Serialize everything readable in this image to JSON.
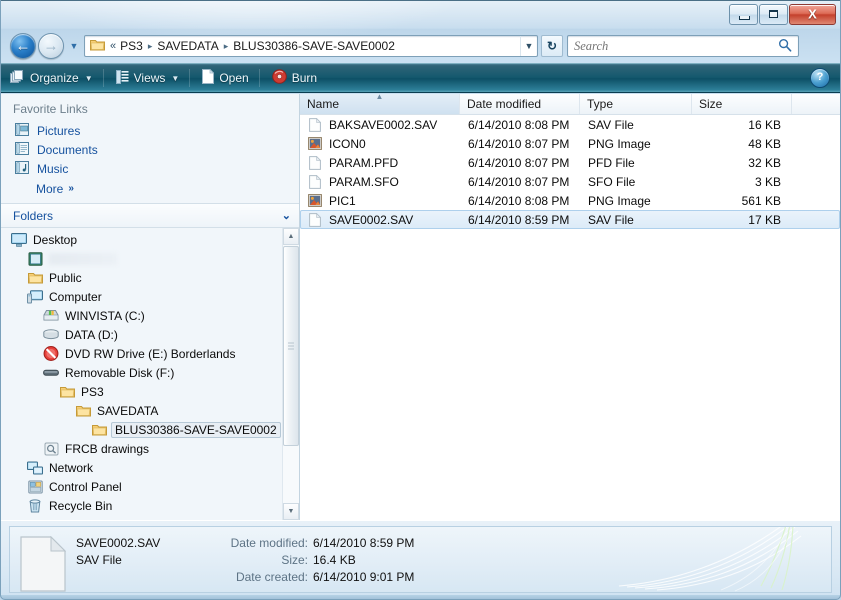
{
  "window": {
    "caption_buttons": {
      "minimize": "minimize-button",
      "maximize": "maximize-button",
      "close_label": "X"
    }
  },
  "address_bar": {
    "back_glyph": "←",
    "forward_glyph": "→",
    "history_caret": "▼",
    "overflow": "«",
    "crumbs": [
      "PS3",
      "SAVEDATA",
      "BLUS30386-SAVE-SAVE0002"
    ],
    "separator": "▸",
    "dropdown_caret": "▼",
    "refresh_glyph": "↻",
    "search": {
      "placeholder": "Search",
      "value": ""
    }
  },
  "toolbar": {
    "organize_label": "Organize",
    "organize_caret": "▼",
    "views_label": "Views",
    "views_caret": "▼",
    "open_label": "Open",
    "burn_label": "Burn",
    "help_glyph": "?"
  },
  "nav_pane": {
    "favorites_header": "Favorite Links",
    "favorites": [
      {
        "label": "Pictures",
        "icon": "pictures-icon"
      },
      {
        "label": "Documents",
        "icon": "documents-icon"
      },
      {
        "label": "Music",
        "icon": "music-icon"
      }
    ],
    "more_label": "More",
    "more_chevron": "»",
    "folders_header": "Folders",
    "folders_chevron": "⌄",
    "tree": [
      {
        "label": "Desktop",
        "indent": 0,
        "icon": "desktop-icon",
        "selected": false,
        "blurred": false
      },
      {
        "label": "",
        "indent": 1,
        "icon": "user-folder-icon",
        "selected": false,
        "blurred": true
      },
      {
        "label": "Public",
        "indent": 1,
        "icon": "folder-icon",
        "selected": false,
        "blurred": false
      },
      {
        "label": "Computer",
        "indent": 1,
        "icon": "computer-icon",
        "selected": false,
        "blurred": false
      },
      {
        "label": "WINVISTA (C:)",
        "indent": 2,
        "icon": "hard-drive-icon",
        "selected": false,
        "blurred": false
      },
      {
        "label": "DATA (D:)",
        "indent": 2,
        "icon": "disk-drive-icon",
        "selected": false,
        "blurred": false
      },
      {
        "label": "DVD RW Drive (E:) Borderlands",
        "indent": 2,
        "icon": "dvd-drive-icon",
        "selected": false,
        "blurred": false
      },
      {
        "label": "Removable Disk (F:)",
        "indent": 2,
        "icon": "removable-disk-icon",
        "selected": false,
        "blurred": false
      },
      {
        "label": "PS3",
        "indent": 3,
        "icon": "folder-icon",
        "selected": false,
        "blurred": false
      },
      {
        "label": "SAVEDATA",
        "indent": 4,
        "icon": "folder-icon",
        "selected": false,
        "blurred": false
      },
      {
        "label": "BLUS30386-SAVE-SAVE0002",
        "indent": 5,
        "icon": "folder-icon",
        "selected": true,
        "blurred": false
      },
      {
        "label": "FRCB drawings",
        "indent": 2,
        "icon": "search-folder-icon",
        "selected": false,
        "blurred": false
      },
      {
        "label": "Network",
        "indent": 1,
        "icon": "network-icon",
        "selected": false,
        "blurred": false
      },
      {
        "label": "Control Panel",
        "indent": 1,
        "icon": "control-panel-icon",
        "selected": false,
        "blurred": false
      },
      {
        "label": "Recycle Bin",
        "indent": 1,
        "icon": "recycle-bin-icon",
        "selected": false,
        "blurred": false
      }
    ]
  },
  "file_list": {
    "columns": [
      {
        "label": "Name",
        "sorted": true,
        "sort_arrow": "▲"
      },
      {
        "label": "Date modified",
        "sorted": false,
        "sort_arrow": ""
      },
      {
        "label": "Type",
        "sorted": false,
        "sort_arrow": ""
      },
      {
        "label": "Size",
        "sorted": false,
        "sort_arrow": ""
      }
    ],
    "rows": [
      {
        "name": "BAKSAVE0002.SAV",
        "date": "6/14/2010 8:08 PM",
        "type": "SAV File",
        "size": "16 KB",
        "icon": "generic-file-icon",
        "selected": false
      },
      {
        "name": "ICON0",
        "date": "6/14/2010 8:07 PM",
        "type": "PNG Image",
        "size": "48 KB",
        "icon": "png-image-icon",
        "selected": false
      },
      {
        "name": "PARAM.PFD",
        "date": "6/14/2010 8:07 PM",
        "type": "PFD File",
        "size": "32 KB",
        "icon": "generic-file-icon",
        "selected": false
      },
      {
        "name": "PARAM.SFO",
        "date": "6/14/2010 8:07 PM",
        "type": "SFO File",
        "size": "3 KB",
        "icon": "generic-file-icon",
        "selected": false
      },
      {
        "name": "PIC1",
        "date": "6/14/2010 8:08 PM",
        "type": "PNG Image",
        "size": "561 KB",
        "icon": "png-image-icon",
        "selected": false
      },
      {
        "name": "SAVE0002.SAV",
        "date": "6/14/2010 8:59 PM",
        "type": "SAV File",
        "size": "17 KB",
        "icon": "generic-file-icon",
        "selected": true
      }
    ]
  },
  "details_pane": {
    "file_name": "SAVE0002.SAV",
    "file_type": "SAV File",
    "date_modified_label": "Date modified:",
    "date_modified_value": "6/14/2010 8:59 PM",
    "size_label": "Size:",
    "size_value": "16.4 KB",
    "date_created_label": "Date created:",
    "date_created_value": "6/14/2010 9:01 PM"
  }
}
